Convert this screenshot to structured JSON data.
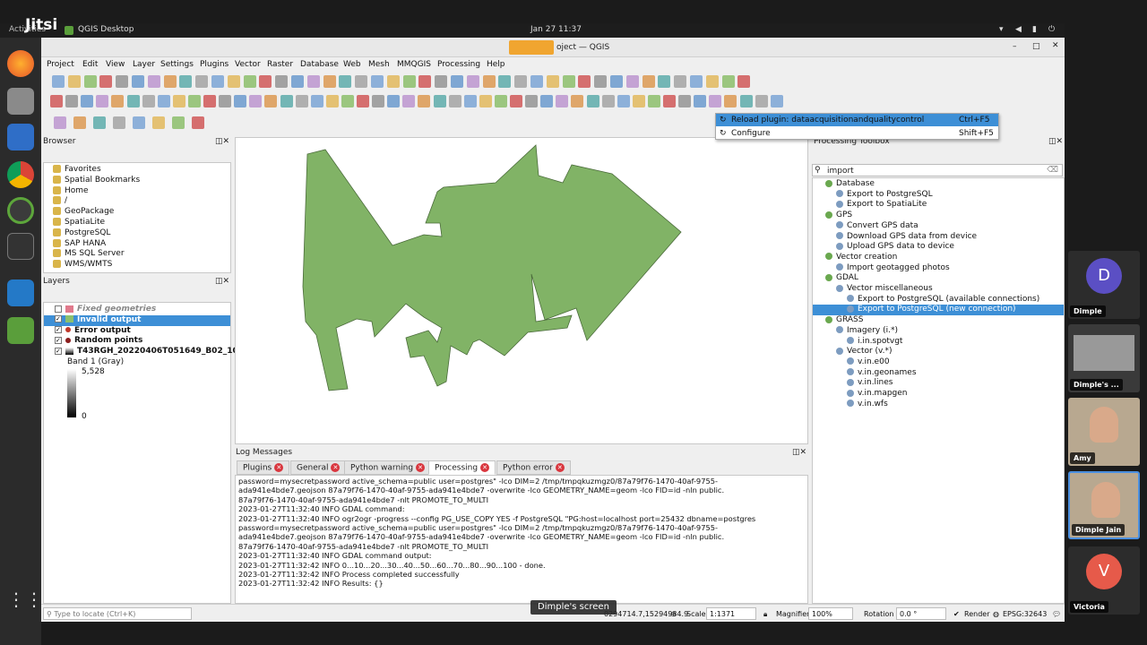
{
  "meeting": {
    "brand": "Jitsi",
    "overlay_label": "Activities",
    "screen_label": "Dimple's screen",
    "participants": [
      {
        "name": "Dimple",
        "initial": "D",
        "color": "#5b4fc4"
      },
      {
        "name": "Dimple's ...",
        "initial": "",
        "color": ""
      },
      {
        "name": "Amy",
        "initial": "",
        "color": ""
      },
      {
        "name": "Dimple Jain",
        "initial": "",
        "color": ""
      },
      {
        "name": "Victoria",
        "initial": "V",
        "color": "#e65a4a"
      }
    ]
  },
  "topbar": {
    "app_name": "QGIS Desktop",
    "clock": "Jan 27  11:37"
  },
  "window": {
    "title": "oject — QGIS"
  },
  "menu": [
    "Project",
    "Edit",
    "View",
    "Layer",
    "Settings",
    "Plugins",
    "Vector",
    "Raster",
    "Database",
    "Web",
    "Mesh",
    "MMQGIS",
    "Processing",
    "Help"
  ],
  "plugin_menu": {
    "items": [
      {
        "label": "Reload plugin: dataacquisitionandqualitycontrol",
        "shortcut": "Ctrl+F5"
      },
      {
        "label": "Configure",
        "shortcut": "Shift+F5"
      }
    ]
  },
  "browser": {
    "title": "Browser",
    "items": [
      "Favorites",
      "Spatial Bookmarks",
      "Home",
      "/",
      "GeoPackage",
      "SpatiaLite",
      "PostgreSQL",
      "SAP HANA",
      "MS SQL Server",
      "WMS/WMTS"
    ]
  },
  "layers": {
    "title": "Layers",
    "items": [
      {
        "name": "Fixed geometries",
        "color": "#e07a8c"
      },
      {
        "name": "Invalid output",
        "color": "#8cc06e"
      },
      {
        "name": "Error output",
        "color": "#c0392b"
      },
      {
        "name": "Random points",
        "color": "#8b1e1e"
      },
      {
        "name": "T43RGH_20220406T051649_B02_10m",
        "color": ""
      }
    ],
    "band_label": "Band 1 (Gray)",
    "band_max": "5,528",
    "band_min": "0"
  },
  "toolbox": {
    "title": "Processing Toolbox",
    "search": "import",
    "tree": [
      {
        "level": 0,
        "label": "Database"
      },
      {
        "level": 1,
        "label": "Export to PostgreSQL"
      },
      {
        "level": 1,
        "label": "Export to SpatiaLite"
      },
      {
        "level": 0,
        "label": "GPS"
      },
      {
        "level": 1,
        "label": "Convert GPS data"
      },
      {
        "level": 1,
        "label": "Download GPS data from device"
      },
      {
        "level": 1,
        "label": "Upload GPS data to device"
      },
      {
        "level": 0,
        "label": "Vector creation"
      },
      {
        "level": 1,
        "label": "Import geotagged photos"
      },
      {
        "level": 0,
        "label": "GDAL"
      },
      {
        "level": 1,
        "label": "Vector miscellaneous"
      },
      {
        "level": 2,
        "label": "Export to PostgreSQL (available connections)"
      },
      {
        "level": 2,
        "label": "Export to PostgreSQL (new connection)"
      },
      {
        "level": 0,
        "label": "GRASS"
      },
      {
        "level": 1,
        "label": "Imagery (i.*)"
      },
      {
        "level": 2,
        "label": "i.in.spotvgt"
      },
      {
        "level": 1,
        "label": "Vector (v.*)"
      },
      {
        "level": 2,
        "label": "v.in.e00"
      },
      {
        "level": 2,
        "label": "v.in.geonames"
      },
      {
        "level": 2,
        "label": "v.in.lines"
      },
      {
        "level": 2,
        "label": "v.in.mapgen"
      },
      {
        "level": 2,
        "label": "v.in.wfs"
      }
    ]
  },
  "log": {
    "title": "Log Messages",
    "tabs": [
      "Plugins",
      "General",
      "Python warning",
      "Processing",
      "Python error"
    ],
    "active_tab": "Processing",
    "lines": [
      "password=mysecretpassword active_schema=public user=postgres\" -lco DIM=2 /tmp/tmpqkuzmgz0/87a79f76-1470-40af-9755-",
      "ada941e4bde7.geojson 87a79f76-1470-40af-9755-ada941e4bde7 -overwrite -lco GEOMETRY_NAME=geom -lco FID=id -nln public.",
      "87a79f76-1470-40af-9755-ada941e4bde7 -nlt PROMOTE_TO_MULTI",
      "2023-01-27T11:32:40     INFO    GDAL command:",
      "2023-01-27T11:32:40     INFO    ogr2ogr -progress --config PG_USE_COPY YES -f PostgreSQL \"PG:host=localhost port=25432 dbname=postgres",
      "password=mysecretpassword active_schema=public user=postgres\" -lco DIM=2 /tmp/tmpqkuzmgz0/87a79f76-1470-40af-9755-",
      "ada941e4bde7.geojson 87a79f76-1470-40af-9755-ada941e4bde7 -overwrite -lco GEOMETRY_NAME=geom -lco FID=id -nln public.",
      "87a79f76-1470-40af-9755-ada941e4bde7 -nlt PROMOTE_TO_MULTI",
      "2023-01-27T11:32:40     INFO    GDAL command output:",
      "2023-01-27T11:32:42     INFO    0...10...20...30...40...50...60...70...80...90...100 - done.",
      "2023-01-27T11:32:42     INFO    Process completed successfully",
      "2023-01-27T11:32:42     INFO    Results: {}"
    ]
  },
  "status": {
    "locator_placeholder": "Type to locate (Ctrl+K)",
    "coordinate": "0294714.7,15294934.9",
    "scale_label": "Scale",
    "scale": "1:1371",
    "magnifier_label": "Magnifier",
    "magnifier": "100%",
    "rotation_label": "Rotation",
    "rotation": "0.0 °",
    "render_label": "Render",
    "crs": "EPSG:32643"
  }
}
